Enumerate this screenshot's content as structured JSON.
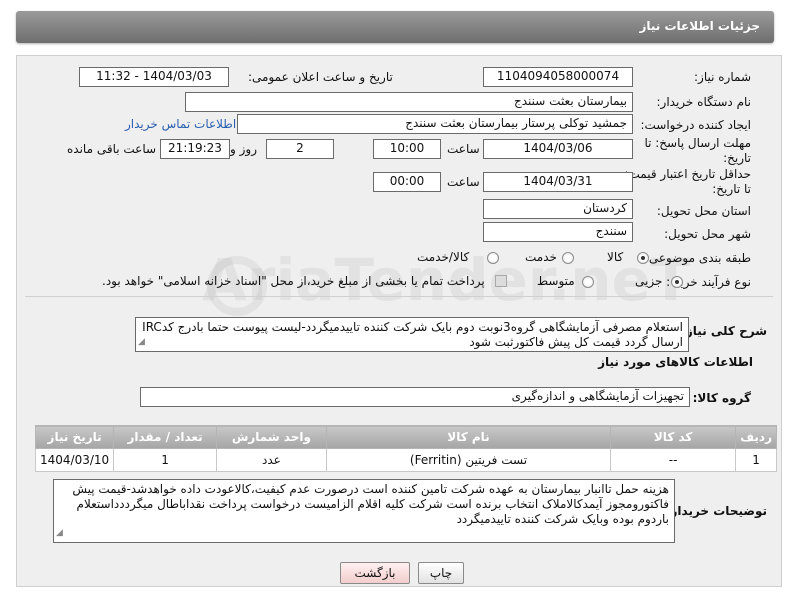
{
  "header": {
    "title": "جزئیات اطلاعات نیاز"
  },
  "fields": {
    "need_number_label": "شماره نیاز:",
    "need_number": "1104094058000074",
    "announce_label": "تاریخ و ساعت اعلان عمومی:",
    "announce_value": "1404/03/03 - 11:32",
    "buyer_org_label": "نام دستگاه خریدار:",
    "buyer_org": "بیمارستان بعثت سنندج",
    "requester_label": "ایجاد کننده درخواست:",
    "requester": "جمشید  توکلی پرستار بیمارستان بعثت سنندج",
    "contact_link": "اطلاعات تماس خریدار",
    "reply_deadline_label_1": "مهلت ارسال پاسخ: تا",
    "reply_deadline_label_2": "تاریخ:",
    "reply_date": "1404/03/06",
    "time_label": "ساعت",
    "reply_time": "10:00",
    "days_value": "2",
    "days_label": "روز و",
    "remaining_time": "21:19:23",
    "remaining_label": "ساعت باقی مانده",
    "price_validity_label_1": "حداقل تاریخ اعتبار قیمت:",
    "price_validity_label_2": "تا تاریخ:",
    "price_date": "1404/03/31",
    "price_time": "00:00",
    "province_label": "استان محل تحویل:",
    "province": "کردستان",
    "city_label": "شهر محل تحویل:",
    "city": "سنندج",
    "category_label": "طبقه بندی موضوعی:",
    "category_options": [
      "کالا",
      "خدمت",
      "کالا/خدمت"
    ],
    "process_label": "نوع فرآیند خرید :",
    "process_options": [
      "جزیی",
      "متوسط"
    ],
    "payment_note": "پرداخت تمام یا بخشی از مبلغ خرید،از محل \"اسناد خزانه اسلامی\" خواهد بود."
  },
  "description": {
    "label": "شرح کلی نیاز:",
    "text": "استعلام مصرفی آزمایشگاهی گروه3نوبت دوم بایک شرکت کننده تاییدمیگردد-لیست پیوست حتما بادرج کدIRC ارسال گردد قیمت کل پیش فاکتورثبت شود"
  },
  "items_section": {
    "title": "اطلاعات کالاهای مورد نیاز",
    "group_label": "گروه کالا:",
    "group_value": "تجهیزات آزمایشگاهی و اندازه‌گیری",
    "columns": [
      "ردیف",
      "کد کالا",
      "نام کالا",
      "واحد شمارش",
      "تعداد / مقدار",
      "تاریخ نیاز"
    ],
    "rows": [
      [
        "1",
        "--",
        "تست فریتین (Ferritin)",
        "عدد",
        "1",
        "1404/03/10"
      ]
    ]
  },
  "buyer_notes": {
    "label": "توضیحات خریدار:",
    "text": "هزینه حمل تاانبار بیمارستان به عهده شرکت تامین کننده است درصورت عدم کیفیت،کالاعودت داده خواهدشد-قیمت پیش فاکتورومجوز آیمدکالاملاک انتخاب برنده است شرکت کلیه اقلام الزامیست درخواست پرداخت نقداباطال میگرددداستعلام باردوم بوده وبایک شرکت کننده تاییدمیگردد"
  },
  "buttons": {
    "print": "چاپ",
    "back": "بازگشت"
  },
  "watermark": {
    "text": "AriaTender.neT"
  }
}
